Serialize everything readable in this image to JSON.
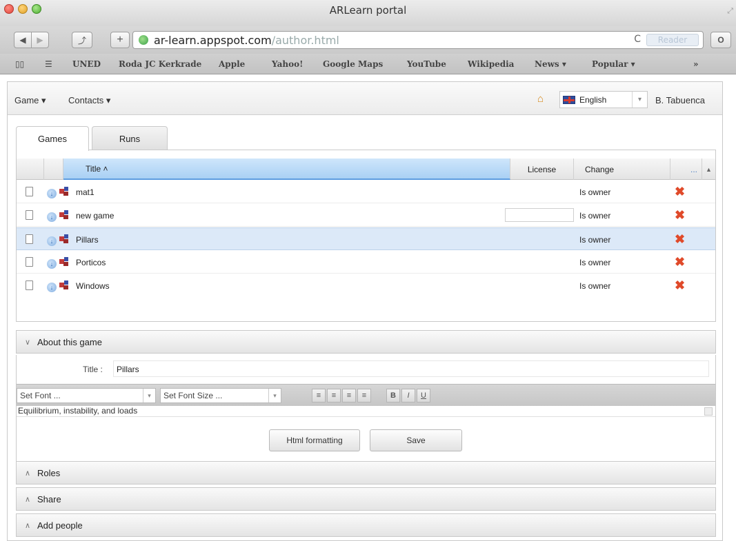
{
  "window": {
    "title": "ARLearn portal"
  },
  "toolbar": {
    "back": "◀",
    "forward": "▶",
    "share": "⤴",
    "new_tab": "+",
    "url_host": "ar-learn.appspot.com",
    "url_path": "/author.html",
    "reload": "C",
    "reader": "Reader",
    "extra": "O"
  },
  "bookmarks": {
    "icons": [
      "book-icon",
      "list-icon"
    ],
    "items": [
      "UNED",
      "Roda JC Kerkrade",
      "Apple",
      "Yahoo!",
      "Google Maps",
      "YouTube",
      "Wikipedia",
      "News ▾",
      "Popular ▾"
    ],
    "more": "»"
  },
  "menu": {
    "game": "Game ▾",
    "contacts": "Contacts ▾"
  },
  "language": {
    "selected": "English",
    "arrow": "▾"
  },
  "user": {
    "name": "B. Tabuenca"
  },
  "tabs": [
    {
      "label": "Games"
    },
    {
      "label": "Runs"
    }
  ],
  "grid": {
    "columns": {
      "title": "Title ˄",
      "license": "License",
      "change": "Change",
      "more": "..."
    },
    "rows": [
      {
        "title": "mat1",
        "change": "Is owner"
      },
      {
        "title": "new game",
        "change": "Is owner"
      },
      {
        "title": "Pillars",
        "change": "Is owner"
      },
      {
        "title": "Porticos",
        "change": "Is owner"
      },
      {
        "title": "Windows",
        "change": "Is owner"
      }
    ]
  },
  "about": {
    "header": "About this game",
    "title_label": "Title :",
    "title_value": "Pillars",
    "font_placeholder": "Set Font ...",
    "font_size_placeholder": "Set Font Size ...",
    "align_buttons": [
      "≡",
      "≡",
      "≡",
      "≡"
    ],
    "bold": "B",
    "italic": "I",
    "underline": "U",
    "description": "Equilibrium, instability, and loads",
    "html_button": "Html formatting",
    "save_button": "Save"
  },
  "sections": {
    "roles": "Roles",
    "share": "Share",
    "add_people": "Add people"
  },
  "colors": {
    "selected_row": "#dce9f8",
    "title_column": "#a9d0f4",
    "delete": "#e04a2a"
  }
}
